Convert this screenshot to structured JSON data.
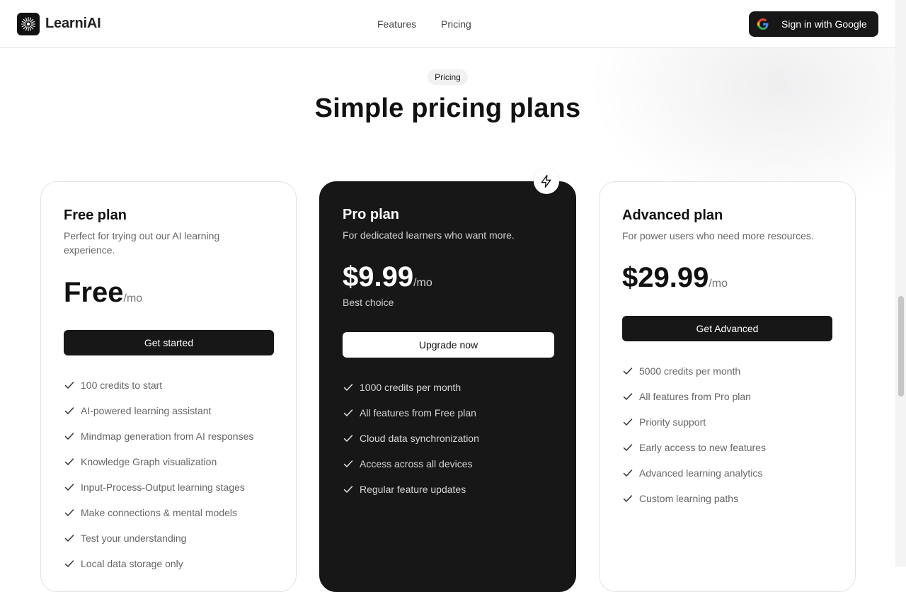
{
  "app": {
    "name": "LearniAI"
  },
  "nav": {
    "items": [
      "Features",
      "Pricing"
    ]
  },
  "auth": {
    "signin_label": "Sign in with Google"
  },
  "hero": {
    "badge": "Pricing",
    "title": "Simple pricing plans"
  },
  "plans": [
    {
      "name": "Free plan",
      "description": "Perfect for trying out our AI learning experience.",
      "price": "Free",
      "period": "/mo",
      "cta": "Get started",
      "features": [
        "100 credits to start",
        "AI-powered learning assistant",
        "Mindmap generation from AI responses",
        "Knowledge Graph visualization",
        "Input-Process-Output learning stages",
        "Make connections & mental models",
        "Test your understanding",
        "Local data storage only"
      ]
    },
    {
      "name": "Pro plan",
      "description": "For dedicated learners who want more.",
      "price": "$9.99",
      "period": "/mo",
      "tagline": "Best choice",
      "cta": "Upgrade now",
      "features": [
        "1000 credits per month",
        "All features from Free plan",
        "Cloud data synchronization",
        "Access across all devices",
        "Regular feature updates"
      ]
    },
    {
      "name": "Advanced plan",
      "description": "For power users who need more resources.",
      "price": "$29.99",
      "period": "/mo",
      "cta": "Get Advanced",
      "features": [
        "5000 credits per month",
        "All features from Pro plan",
        "Priority support",
        "Early access to new features",
        "Advanced learning analytics",
        "Custom learning paths"
      ]
    }
  ],
  "icons": {
    "logo": "sparkle-burst-icon",
    "google": "google-icon",
    "check": "check-icon",
    "featured": "lightning-bolt-icon"
  },
  "colors": {
    "primary_dark": "#171717",
    "border": "#e3e3e3",
    "muted_text": "#666666"
  }
}
